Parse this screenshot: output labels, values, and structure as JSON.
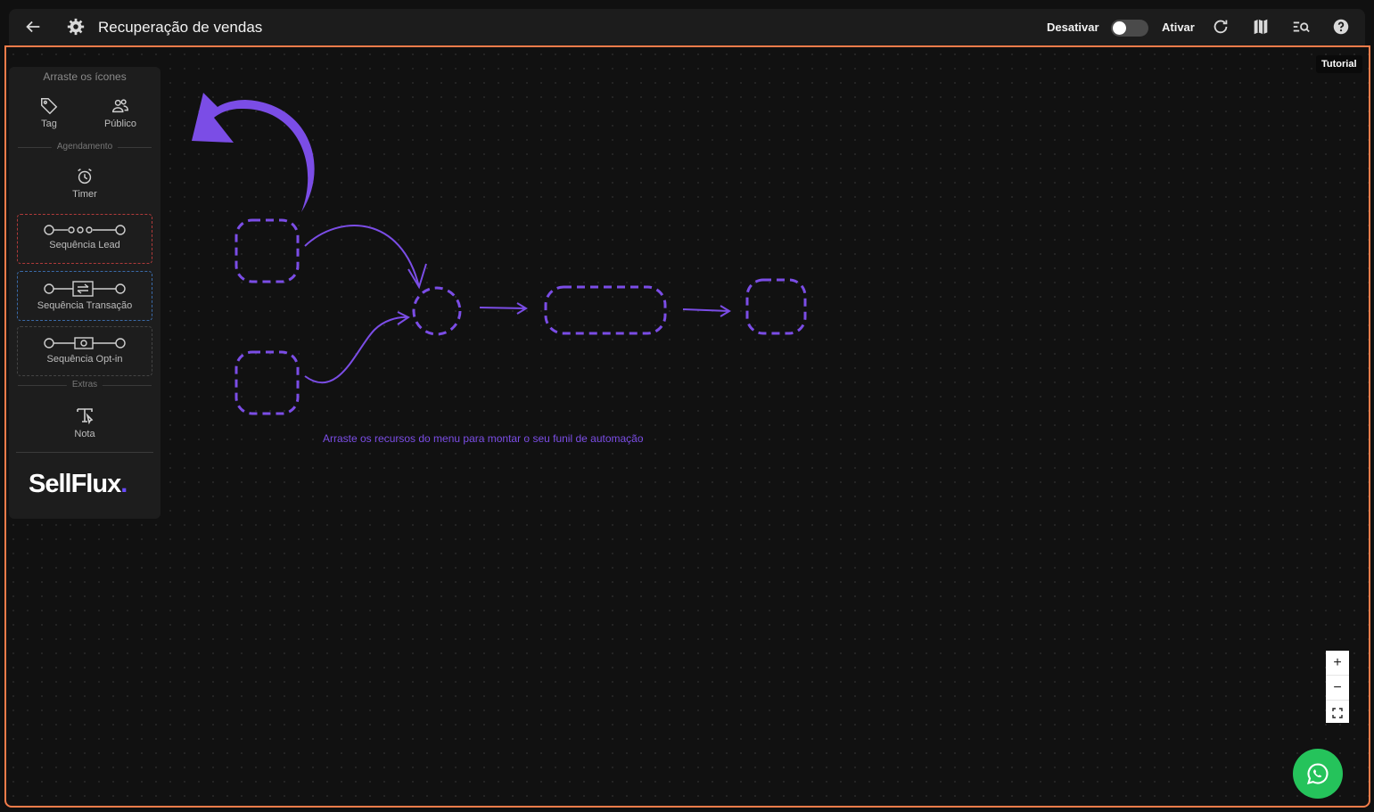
{
  "header": {
    "title": "Recuperação de vendas",
    "deactivate_label": "Desativar",
    "activate_label": "Ativar",
    "tooltip": "Tutorial",
    "toggle_on": false
  },
  "palette": {
    "title": "Arraste os ícones",
    "tag_label": "Tag",
    "public_label": "Público",
    "scheduling_section": "Agendamento",
    "timer_label": "Timer",
    "seq_lead_label": "Sequência Lead",
    "seq_transaction_label": "Sequência Transação",
    "seq_optin_label": "Sequência Opt-in",
    "extras_section": "Extras",
    "note_label": "Nota",
    "logo_text": "SellFlux",
    "logo_dot": "."
  },
  "canvas": {
    "hint": "Arraste os recursos do menu para montar o seu funil de automação",
    "accent_color": "#7b4de6",
    "frame_color": "#f47c4a"
  },
  "zoom": {
    "in": "+",
    "out": "−"
  }
}
